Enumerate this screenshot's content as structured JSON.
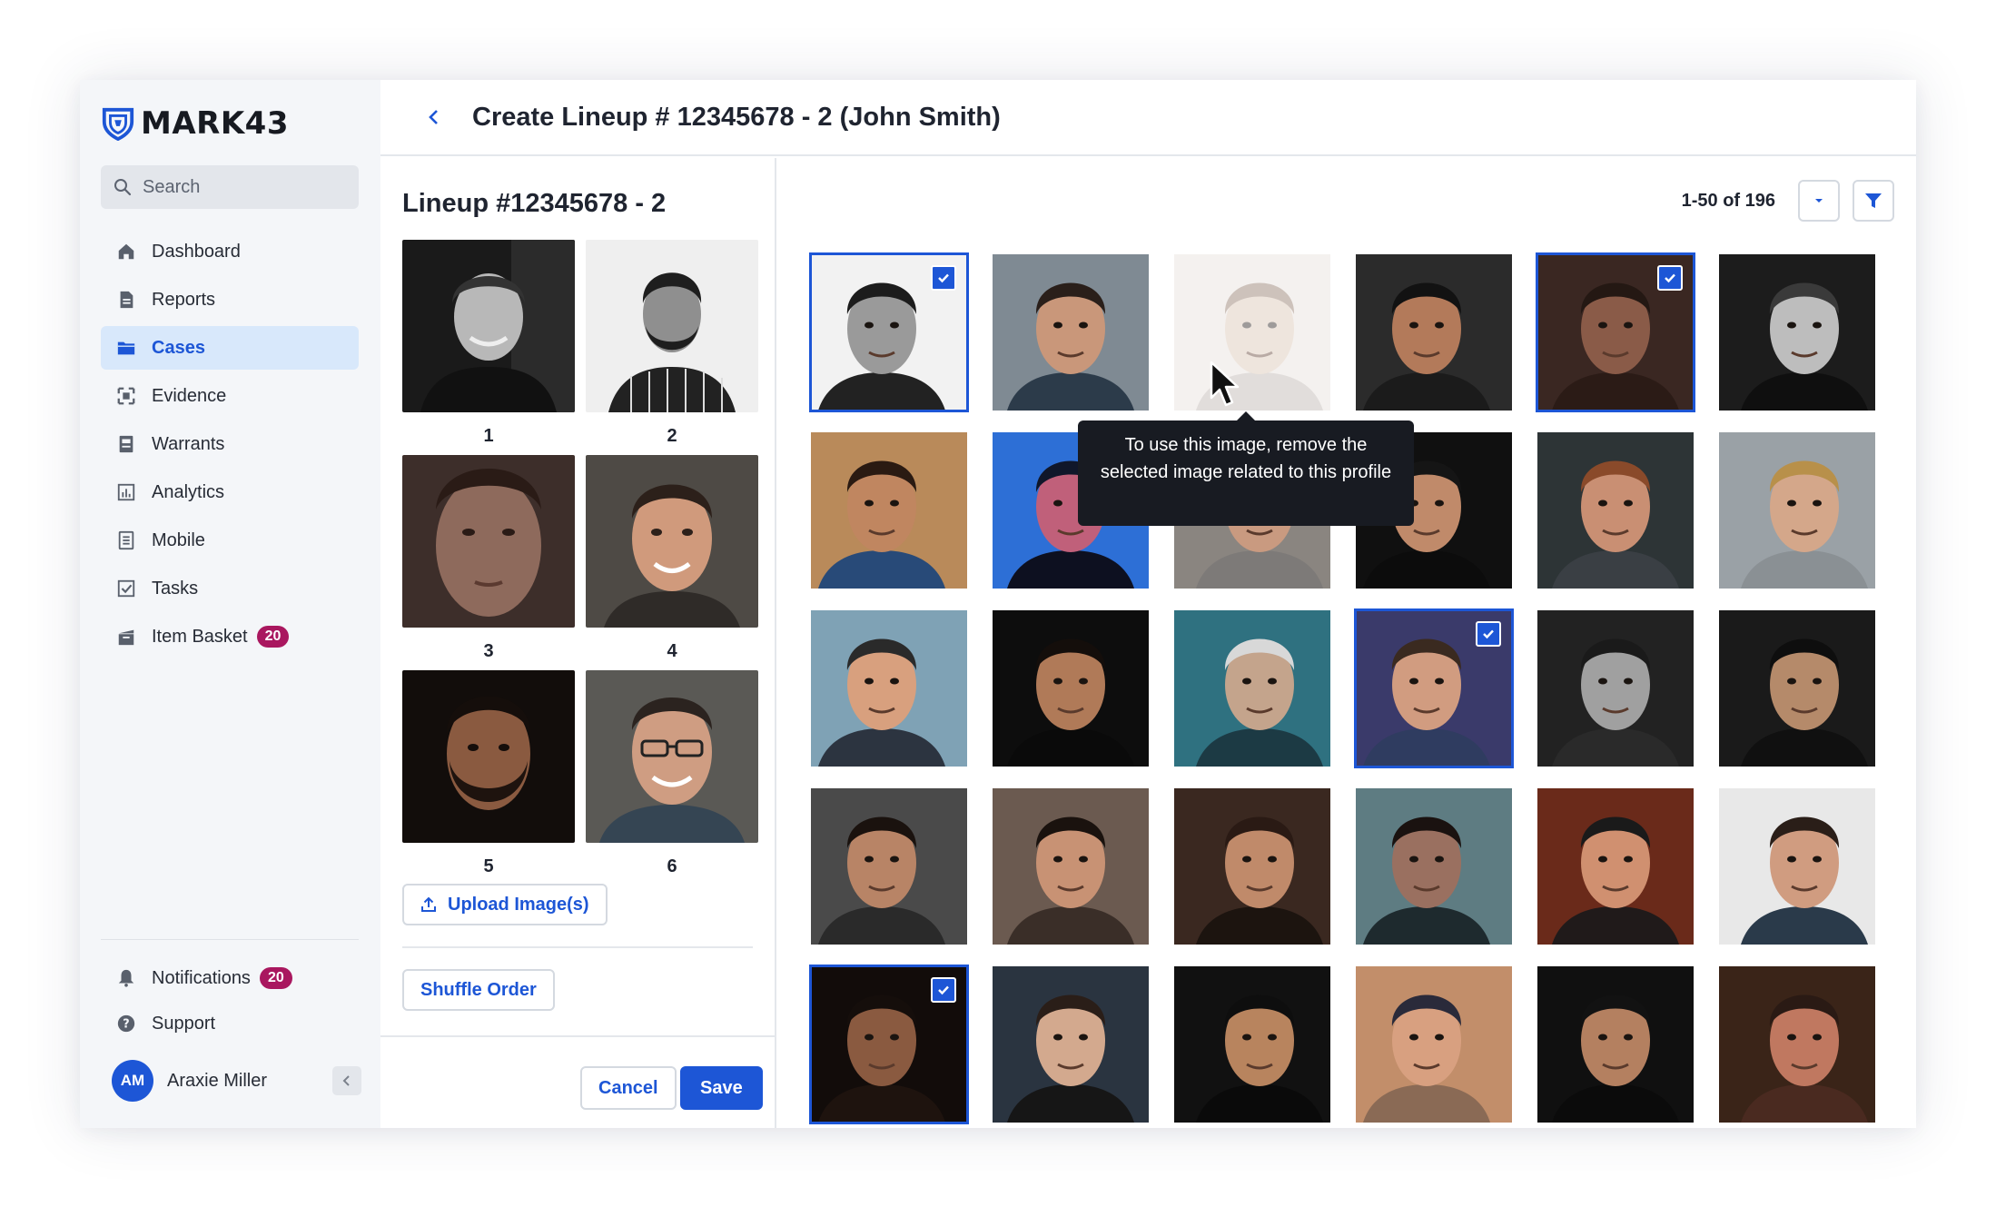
{
  "brand": {
    "name": "MARK43",
    "accent": "#1d56d6"
  },
  "search": {
    "placeholder": "Search"
  },
  "nav": [
    {
      "label": "Dashboard",
      "icon": "home-icon"
    },
    {
      "label": "Reports",
      "icon": "document-icon"
    },
    {
      "label": "Cases",
      "icon": "folder-icon",
      "active": true
    },
    {
      "label": "Evidence",
      "icon": "evidence-icon"
    },
    {
      "label": "Warrants",
      "icon": "warrant-icon"
    },
    {
      "label": "Analytics",
      "icon": "chart-icon"
    },
    {
      "label": "Mobile",
      "icon": "mobile-icon"
    },
    {
      "label": "Tasks",
      "icon": "checkbox-icon"
    },
    {
      "label": "Item Basket",
      "icon": "basket-icon",
      "badge": "20"
    }
  ],
  "bottom_nav": [
    {
      "label": "Notifications",
      "icon": "bell-icon",
      "badge": "20"
    },
    {
      "label": "Support",
      "icon": "help-icon"
    }
  ],
  "user": {
    "initials": "AM",
    "name": "Araxie Miller"
  },
  "header": {
    "title": "Create Lineup # 12345678 - 2 (John Smith)"
  },
  "lineup": {
    "title": "Lineup #12345678 - 2",
    "slots": [
      "1",
      "2",
      "3",
      "4",
      "5",
      "6"
    ],
    "upload_label": "Upload Image(s)",
    "shuffle_label": "Shuffle Order",
    "cancel_label": "Cancel",
    "save_label": "Save"
  },
  "results": {
    "pager": "1-50 of 196",
    "tooltip": "To use this image, remove the selected image related to this profile",
    "selected": [
      0,
      4,
      15,
      24
    ],
    "disabled": [
      2
    ]
  }
}
